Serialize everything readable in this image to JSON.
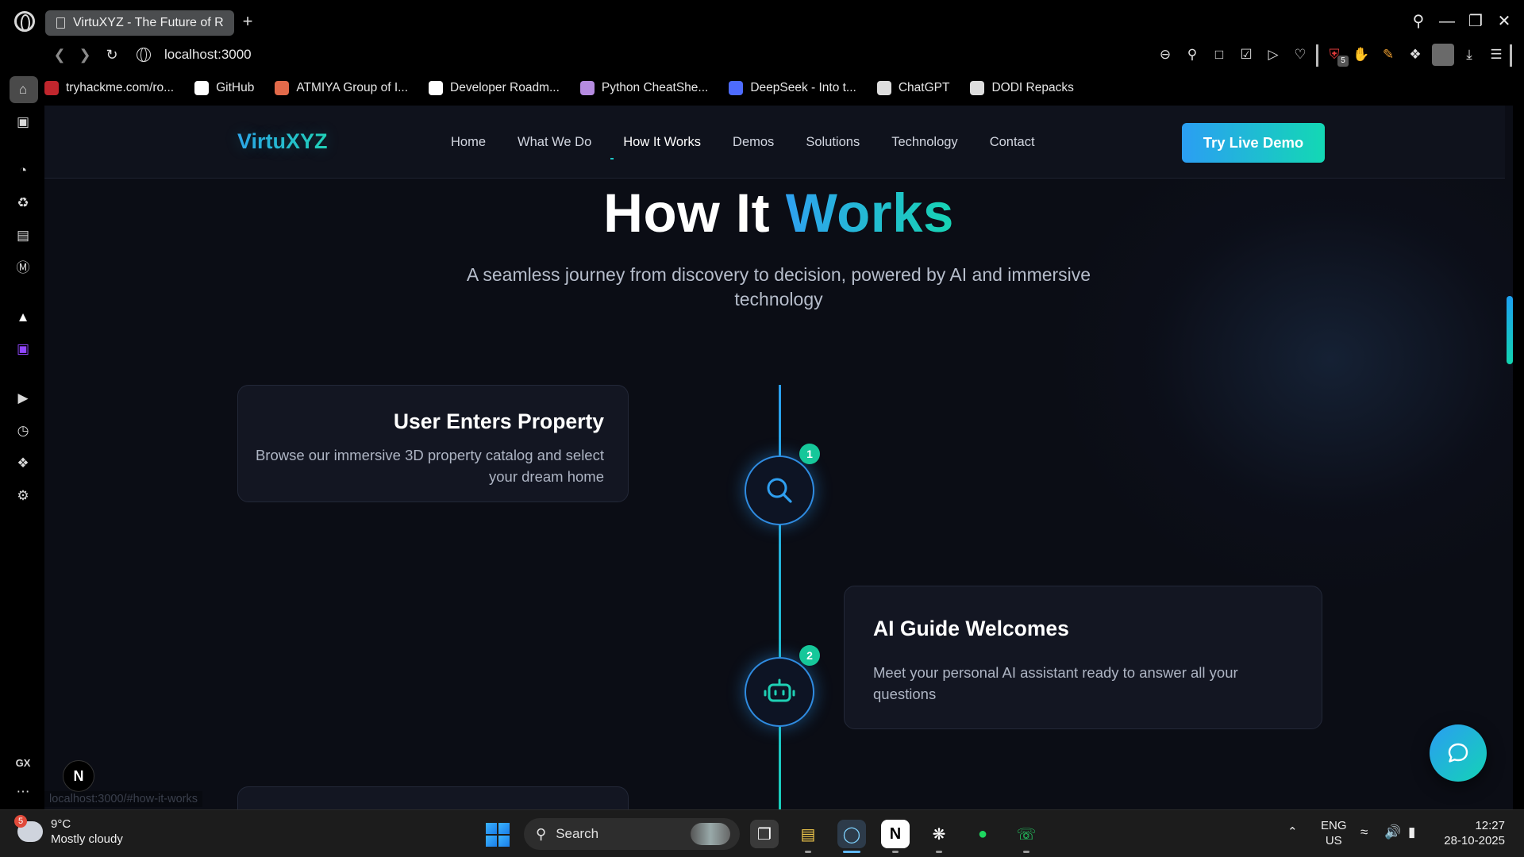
{
  "browser": {
    "tab_title": "VirtuXYZ - The Future of R",
    "url": "localhost:3000",
    "status_url": "localhost:3000/#how-it-works",
    "extension_badge": "5",
    "bookmarks": [
      {
        "label": "tryhackme.com/ro...",
        "icon": "tryhackme-icon",
        "color": "#c0262d"
      },
      {
        "label": "GitHub",
        "icon": "github-icon",
        "color": "#ffffff"
      },
      {
        "label": "ATMIYA Group of I...",
        "icon": "atmiya-icon",
        "color": "#e26a4a"
      },
      {
        "label": "Developer Roadm...",
        "icon": "roadmap-icon",
        "color": "#ffffff"
      },
      {
        "label": "Python CheatShe...",
        "icon": "python-icon",
        "color": "#b58be0"
      },
      {
        "label": "DeepSeek - Into t...",
        "icon": "deepseek-icon",
        "color": "#4d6bfe"
      },
      {
        "label": "ChatGPT",
        "icon": "chatgpt-icon",
        "color": "#dddddd"
      },
      {
        "label": "DODI Repacks",
        "icon": "document-icon",
        "color": "#dddddd"
      }
    ],
    "sidebar_bottom_label": "GX"
  },
  "site": {
    "brand": "VirtuXYZ",
    "nav": [
      "Home",
      "What We Do",
      "How It Works",
      "Demos",
      "Solutions",
      "Technology",
      "Contact"
    ],
    "active_nav": "How It Works",
    "cta": "Try Live Demo",
    "heading_plain": "How It",
    "heading_accent": "Works",
    "subtitle": "A seamless journey from discovery to decision, powered by AI and immersive technology",
    "steps": [
      {
        "number": "1",
        "title": "User Enters Property",
        "description": "Browse our immersive 3D property catalog and select your dream home",
        "icon": "search-icon",
        "side": "left"
      },
      {
        "number": "2",
        "title": "AI Guide Welcomes",
        "description": "Meet your personal AI assistant ready to answer all your questions",
        "icon": "robot-icon",
        "side": "right"
      }
    ],
    "next_dev_badge": "N"
  },
  "colors": {
    "accent_blue": "#2fa1f0",
    "accent_teal": "#17d4b3",
    "badge_green": "#16c79a",
    "page_bg": "#0b0d15"
  },
  "taskbar": {
    "weather_badge": "5",
    "temperature": "9°C",
    "weather": "Mostly cloudy",
    "search_placeholder": "Search",
    "lang_top": "ENG",
    "lang_bottom": "US",
    "time": "12:27",
    "date": "28-10-2025"
  }
}
